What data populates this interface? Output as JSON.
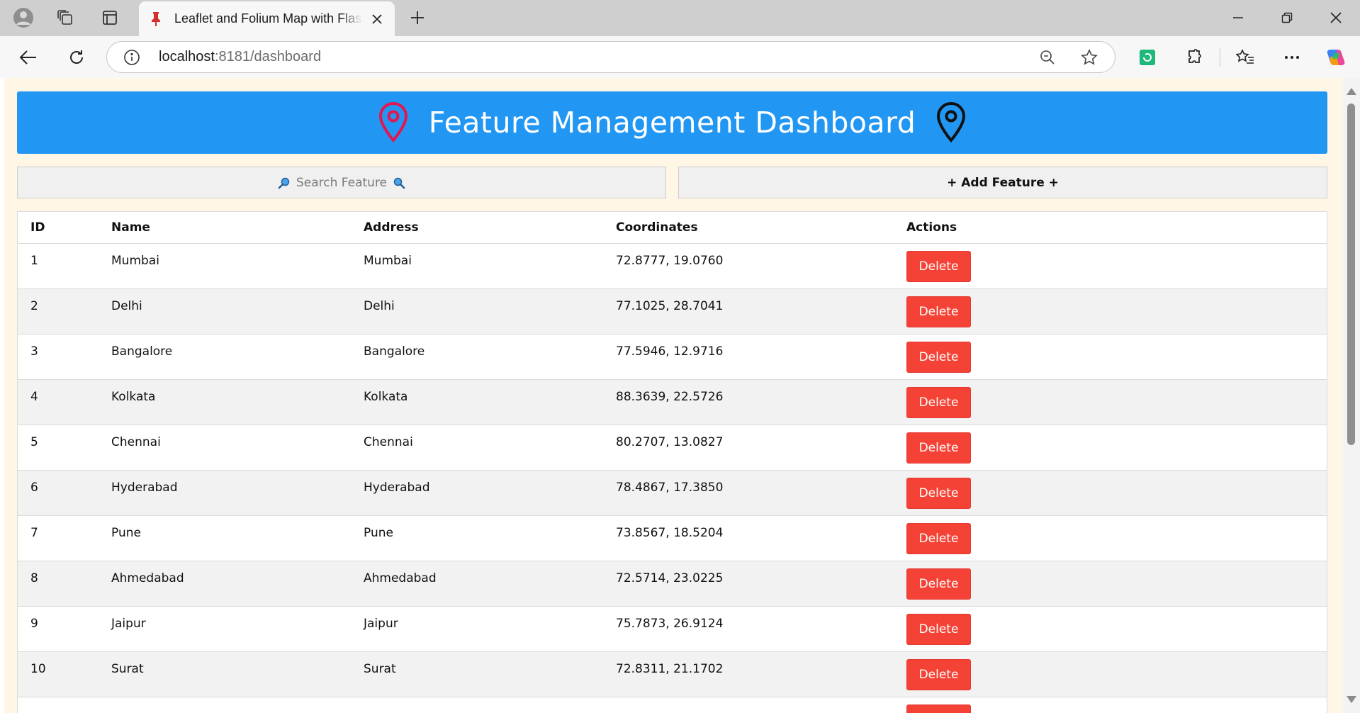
{
  "browser": {
    "tab_title": "Leaflet and Folium Map with Flask",
    "url_host": "localhost",
    "url_rest": ":8181/dashboard"
  },
  "colors": {
    "header_bg": "#2196f3",
    "delete_bg": "#f44336",
    "page_bg": "#fff6e6"
  },
  "header": {
    "title": "Feature Management Dashboard",
    "left_icon": "map-pin-icon-red",
    "right_icon": "map-pin-icon-black"
  },
  "controls": {
    "search_label": "Search Feature",
    "add_label": "+ Add Feature +"
  },
  "table": {
    "columns": [
      "ID",
      "Name",
      "Address",
      "Coordinates",
      "Actions"
    ],
    "delete_label": "Delete",
    "rows": [
      {
        "id": "1",
        "name": "Mumbai",
        "address": "Mumbai",
        "coords": "72.8777, 19.0760"
      },
      {
        "id": "2",
        "name": "Delhi",
        "address": "Delhi",
        "coords": "77.1025, 28.7041"
      },
      {
        "id": "3",
        "name": "Bangalore",
        "address": "Bangalore",
        "coords": "77.5946, 12.9716"
      },
      {
        "id": "4",
        "name": "Kolkata",
        "address": "Kolkata",
        "coords": "88.3639, 22.5726"
      },
      {
        "id": "5",
        "name": "Chennai",
        "address": "Chennai",
        "coords": "80.2707, 13.0827"
      },
      {
        "id": "6",
        "name": "Hyderabad",
        "address": "Hyderabad",
        "coords": "78.4867, 17.3850"
      },
      {
        "id": "7",
        "name": "Pune",
        "address": "Pune",
        "coords": "73.8567, 18.5204"
      },
      {
        "id": "8",
        "name": "Ahmedabad",
        "address": "Ahmedabad",
        "coords": "72.5714, 23.0225"
      },
      {
        "id": "9",
        "name": "Jaipur",
        "address": "Jaipur",
        "coords": "75.7873, 26.9124"
      },
      {
        "id": "10",
        "name": "Surat",
        "address": "Surat",
        "coords": "72.8311, 21.1702"
      }
    ]
  }
}
